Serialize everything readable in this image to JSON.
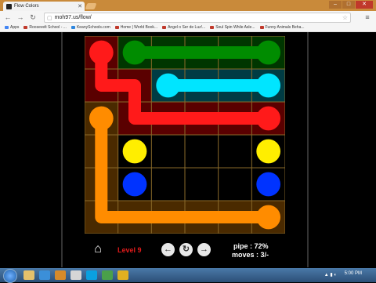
{
  "browser": {
    "tab_title": "Flow Colors",
    "url": "moh97.us/flow/",
    "window_controls": [
      "–",
      "□",
      "✕"
    ]
  },
  "bookmarks": [
    {
      "label": "Apps",
      "color": "#4285f4"
    },
    {
      "label": "Roosevelt School - ...",
      "color": "#c0392b"
    },
    {
      "label": "KeanySchools.com",
      "color": "#2e86de"
    },
    {
      "label": "Home | World Book...",
      "color": "#c0392b"
    },
    {
      "label": "Angel o Ser de Luz!...",
      "color": "#c0392b"
    },
    {
      "label": "Soul Spin While Asle...",
      "color": "#c0392b"
    },
    {
      "label": "Funny Animals Beha...",
      "color": "#c0392b"
    }
  ],
  "game": {
    "grid_size": 6,
    "level_label": "Level 9",
    "pipe_label": "pipe : 72%",
    "moves_label": "moves : 3/-",
    "colors": {
      "red": "#ff1a1a",
      "green": "#008c00",
      "cyan": "#00e5ff",
      "orange": "#ff8c00",
      "yellow": "#ffee00",
      "blue": "#0033ff"
    },
    "dots": [
      {
        "color": "red",
        "row": 0,
        "col": 0
      },
      {
        "color": "green",
        "row": 0,
        "col": 1
      },
      {
        "color": "green",
        "row": 0,
        "col": 5
      },
      {
        "color": "cyan",
        "row": 1,
        "col": 2
      },
      {
        "color": "cyan",
        "row": 1,
        "col": 5
      },
      {
        "color": "red",
        "row": 2,
        "col": 5
      },
      {
        "color": "orange",
        "row": 2,
        "col": 0
      },
      {
        "color": "yellow",
        "row": 3,
        "col": 1
      },
      {
        "color": "yellow",
        "row": 3,
        "col": 5
      },
      {
        "color": "blue",
        "row": 4,
        "col": 1
      },
      {
        "color": "blue",
        "row": 4,
        "col": 5
      },
      {
        "color": "orange",
        "row": 5,
        "col": 5
      }
    ],
    "paths": [
      {
        "color": "red",
        "cells": [
          [
            0,
            0
          ],
          [
            1,
            0
          ],
          [
            1,
            1
          ],
          [
            2,
            1
          ],
          [
            2,
            2
          ],
          [
            2,
            3
          ],
          [
            2,
            4
          ],
          [
            2,
            5
          ]
        ]
      },
      {
        "color": "green",
        "cells": [
          [
            0,
            1
          ],
          [
            0,
            2
          ],
          [
            0,
            3
          ],
          [
            0,
            4
          ],
          [
            0,
            5
          ]
        ]
      },
      {
        "color": "cyan",
        "cells": [
          [
            1,
            2
          ],
          [
            1,
            3
          ],
          [
            1,
            4
          ],
          [
            1,
            5
          ]
        ]
      },
      {
        "color": "orange",
        "cells": [
          [
            2,
            0
          ],
          [
            3,
            0
          ],
          [
            4,
            0
          ],
          [
            5,
            0
          ],
          [
            5,
            1
          ],
          [
            5,
            2
          ],
          [
            5,
            3
          ],
          [
            5,
            4
          ],
          [
            5,
            5
          ]
        ]
      }
    ],
    "cell_fill": [
      [
        "red",
        "green",
        "green",
        "green",
        "green",
        "green"
      ],
      [
        "red",
        "red",
        "cyan",
        "cyan",
        "cyan",
        "cyan"
      ],
      [
        "orange",
        "red",
        "red",
        "red",
        "red",
        "red"
      ],
      [
        "orange",
        "none",
        "none",
        "none",
        "none",
        "none"
      ],
      [
        "orange",
        "none",
        "none",
        "none",
        "none",
        "none"
      ],
      [
        "orange",
        "orange",
        "orange",
        "orange",
        "orange",
        "orange"
      ]
    ]
  },
  "controls": {
    "home_icon": "⌂",
    "prev_icon": "←",
    "restart_icon": "↻",
    "next_icon": "→"
  },
  "taskbar": {
    "time": "5:00 PM"
  }
}
